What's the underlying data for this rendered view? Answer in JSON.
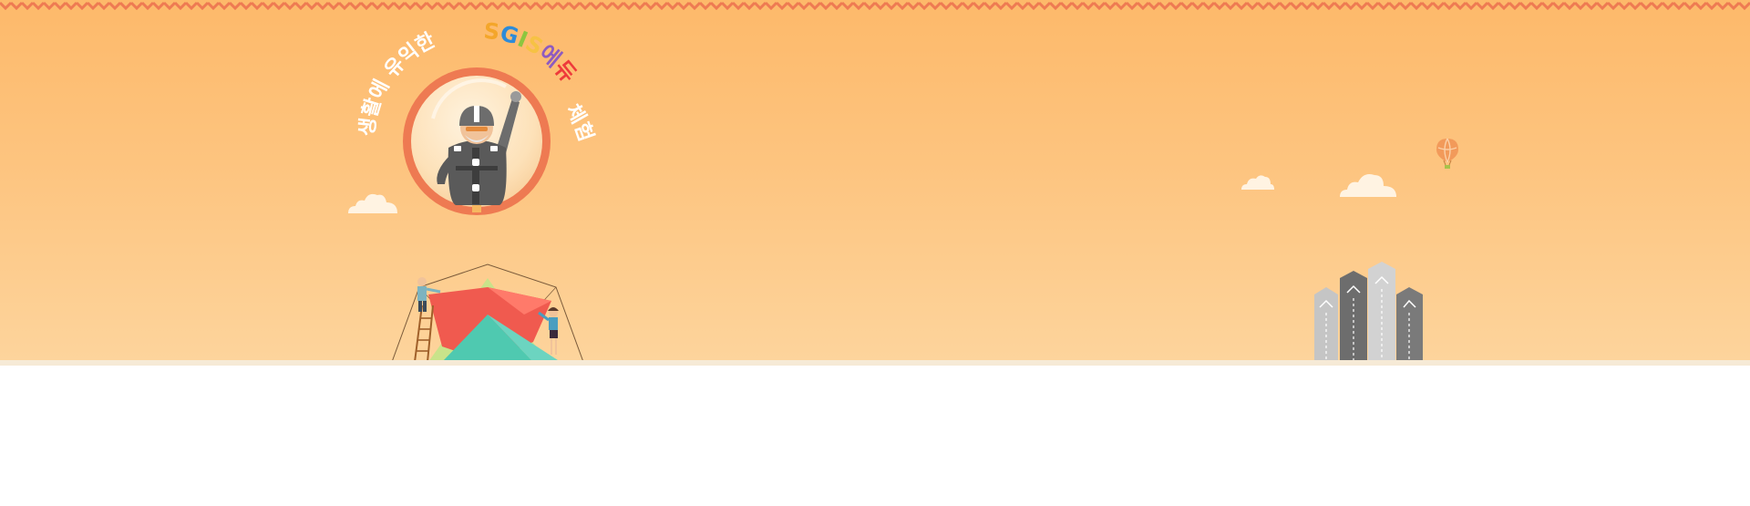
{
  "banner": {
    "arc_text_left": "생활에 유익한",
    "arc_text_brand": "SGIS에듀",
    "arc_text_right": "체험",
    "brand_letter_colors": [
      "#f4a62a",
      "#2e8bd8",
      "#8cc63f",
      "#f6c244",
      "#8e5bc0",
      "#ee3b3b"
    ]
  },
  "colors": {
    "sky_top": "#fdb96a",
    "sky_bottom": "#fdd49c",
    "ring": "#ee7a52",
    "zigzag": "#ee7a52"
  }
}
